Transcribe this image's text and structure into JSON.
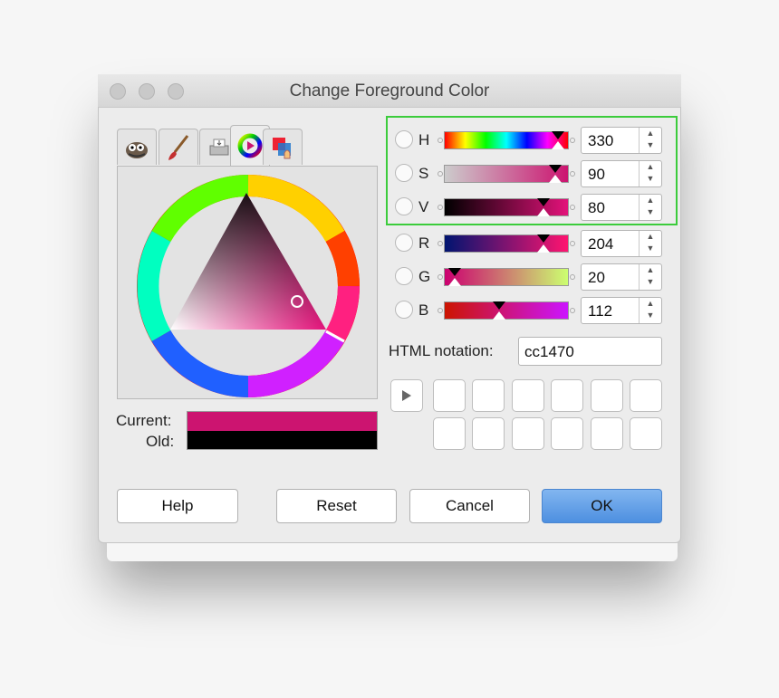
{
  "window": {
    "title": "Change Foreground Color"
  },
  "tabs": [
    {
      "icon": "gimp-icon"
    },
    {
      "icon": "brush-icon"
    },
    {
      "icon": "printer-icon"
    },
    {
      "icon": "color-wheel-icon"
    },
    {
      "icon": "palette-icon"
    }
  ],
  "current_label": "Current:",
  "old_label": "Old:",
  "current_color": "#cc1470",
  "old_color": "#000000",
  "channels": [
    {
      "label": "H",
      "value": "330"
    },
    {
      "label": "S",
      "value": "90"
    },
    {
      "label": "V",
      "value": "80"
    },
    {
      "label": "R",
      "value": "204"
    },
    {
      "label": "G",
      "value": "20"
    },
    {
      "label": "B",
      "value": "112"
    }
  ],
  "html_notation": {
    "label": "HTML notation:",
    "value": "cc1470"
  },
  "buttons": {
    "help": "Help",
    "reset": "Reset",
    "cancel": "Cancel",
    "ok": "OK"
  },
  "colors": {
    "accent": "#4d8fe0",
    "highlight": "#3ccc3c"
  }
}
